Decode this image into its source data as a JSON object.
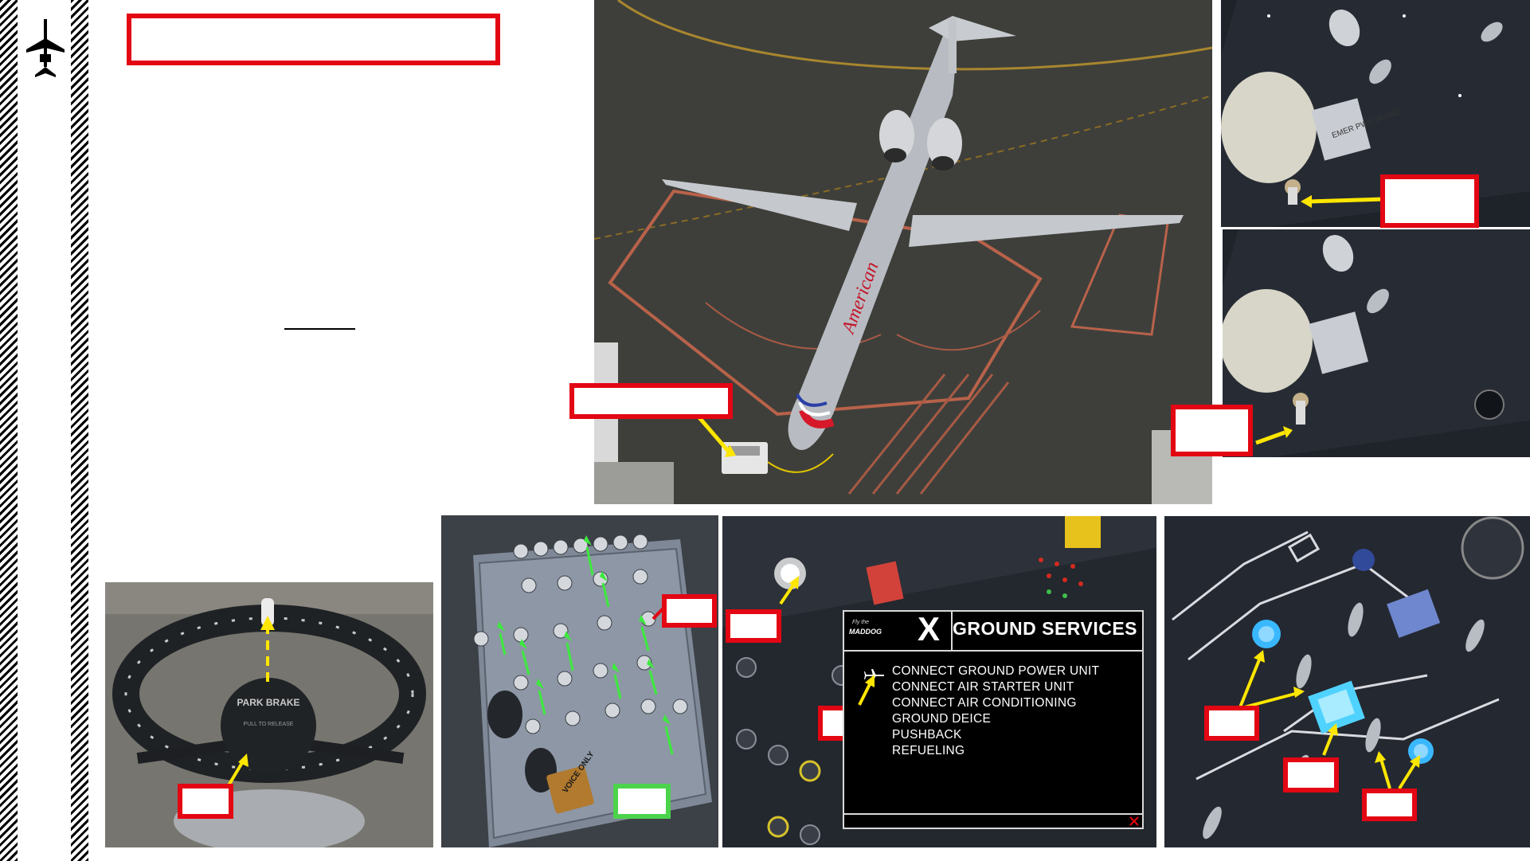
{
  "slide": {
    "logo_icon": "airplane-icon"
  },
  "photos": {
    "aircraft_label": "American",
    "parking_brake_text": "PARK BRAKE",
    "parking_brake_sub": "PULL TO RELEASE",
    "voice_only_label": "VOICE ONLY",
    "emer_pwr_label": "EMER PWR IN USE"
  },
  "ground_services": {
    "brand_small": "Fly the",
    "brand": "MADDOG",
    "brand_x": "X",
    "title": "GROUND SERVICES",
    "items": [
      "CONNECT GROUND POWER UNIT",
      "CONNECT AIR STARTER UNIT",
      "CONNECT AIR CONDITIONING",
      "GROUND DEICE",
      "PUSHBACK",
      "REFUELING"
    ],
    "close_icon": "close-icon"
  },
  "colors": {
    "callout_red": "#e30613",
    "callout_green": "#4cd34c",
    "arrow_yellow": "#ffe600",
    "arrow_green": "#3dea3d"
  }
}
